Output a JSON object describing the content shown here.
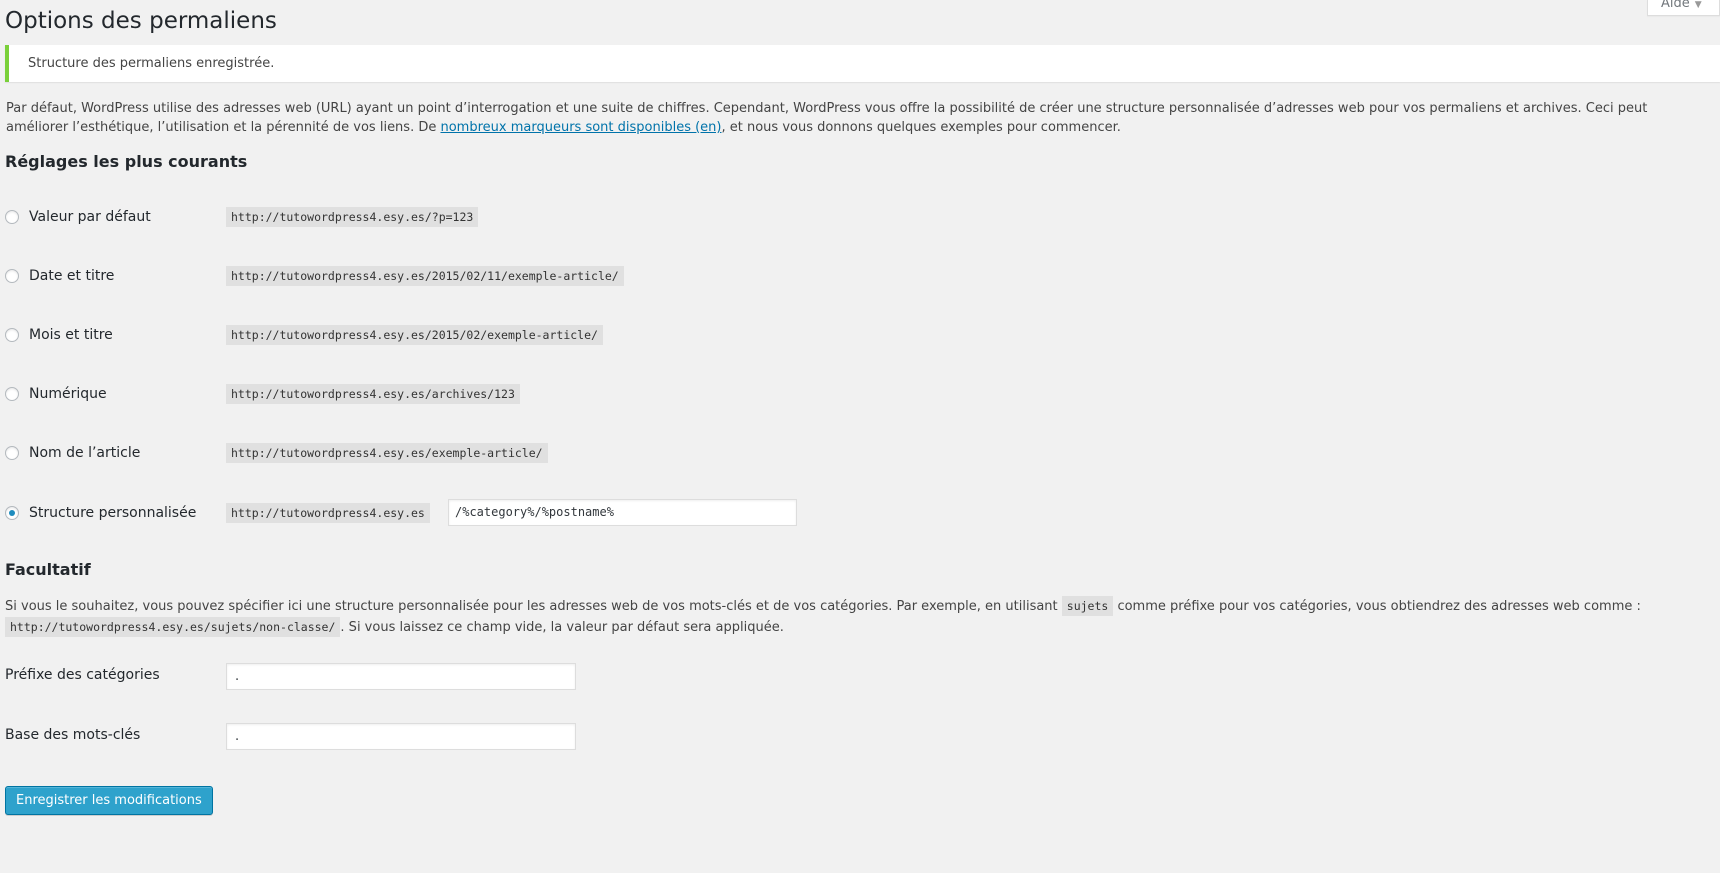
{
  "help": {
    "label": "Aide"
  },
  "page": {
    "title": "Options des permaliens"
  },
  "notice": {
    "text": "Structure des permaliens enregistrée."
  },
  "intro": {
    "text_before": "Par défaut, WordPress utilise des adresses web (URL) ayant un point d’interrogation et une suite de chiffres. Cependant, WordPress vous offre la possibilité de créer une structure personnalisée d’adresses web pour vos permaliens et archives. Ceci peut améliorer l’esthétique, l’utilisation et la pérennité de vos liens. De ",
    "link_text": "nombreux marqueurs sont disponibles (en)",
    "text_after": ", et nous vous donnons quelques exemples pour commencer."
  },
  "common": {
    "heading": "Réglages les plus courants",
    "options": [
      {
        "label": "Valeur par défaut",
        "example": "http://tutowordpress4.esy.es/?p=123",
        "checked": false
      },
      {
        "label": "Date et titre",
        "example": "http://tutowordpress4.esy.es/2015/02/11/exemple-article/",
        "checked": false
      },
      {
        "label": "Mois et titre",
        "example": "http://tutowordpress4.esy.es/2015/02/exemple-article/",
        "checked": false
      },
      {
        "label": "Numérique",
        "example": "http://tutowordpress4.esy.es/archives/123",
        "checked": false
      },
      {
        "label": "Nom de l’article",
        "example": "http://tutowordpress4.esy.es/exemple-article/",
        "checked": false
      },
      {
        "label": "Structure personnalisée",
        "example": "http://tutowordpress4.esy.es",
        "checked": true,
        "value": "/%category%/%postname%"
      }
    ]
  },
  "optional": {
    "heading": "Facultatif",
    "text_1": "Si vous le souhaitez, vous pouvez spécifier ici une structure personnalisée pour les adresses web de vos mots-clés et de vos catégories. Par exemple, en utilisant ",
    "code_1": "sujets",
    "text_2": " comme préfixe pour vos catégories, vous obtiendrez des adresses web comme :",
    "code_2": "http://tutowordpress4.esy.es/sujets/non-classe/",
    "text_3": ". Si vous laissez ce champ vide, la valeur par défaut sera appliquée.",
    "category_label": "Préfixe des catégories",
    "category_value": ".",
    "tag_label": "Base des mots-clés",
    "tag_value": "."
  },
  "save": {
    "label": "Enregistrer les modifications"
  },
  "colors": {
    "accent": "#2ea2cc",
    "notice": "#7ad03a",
    "link": "#0073aa"
  }
}
